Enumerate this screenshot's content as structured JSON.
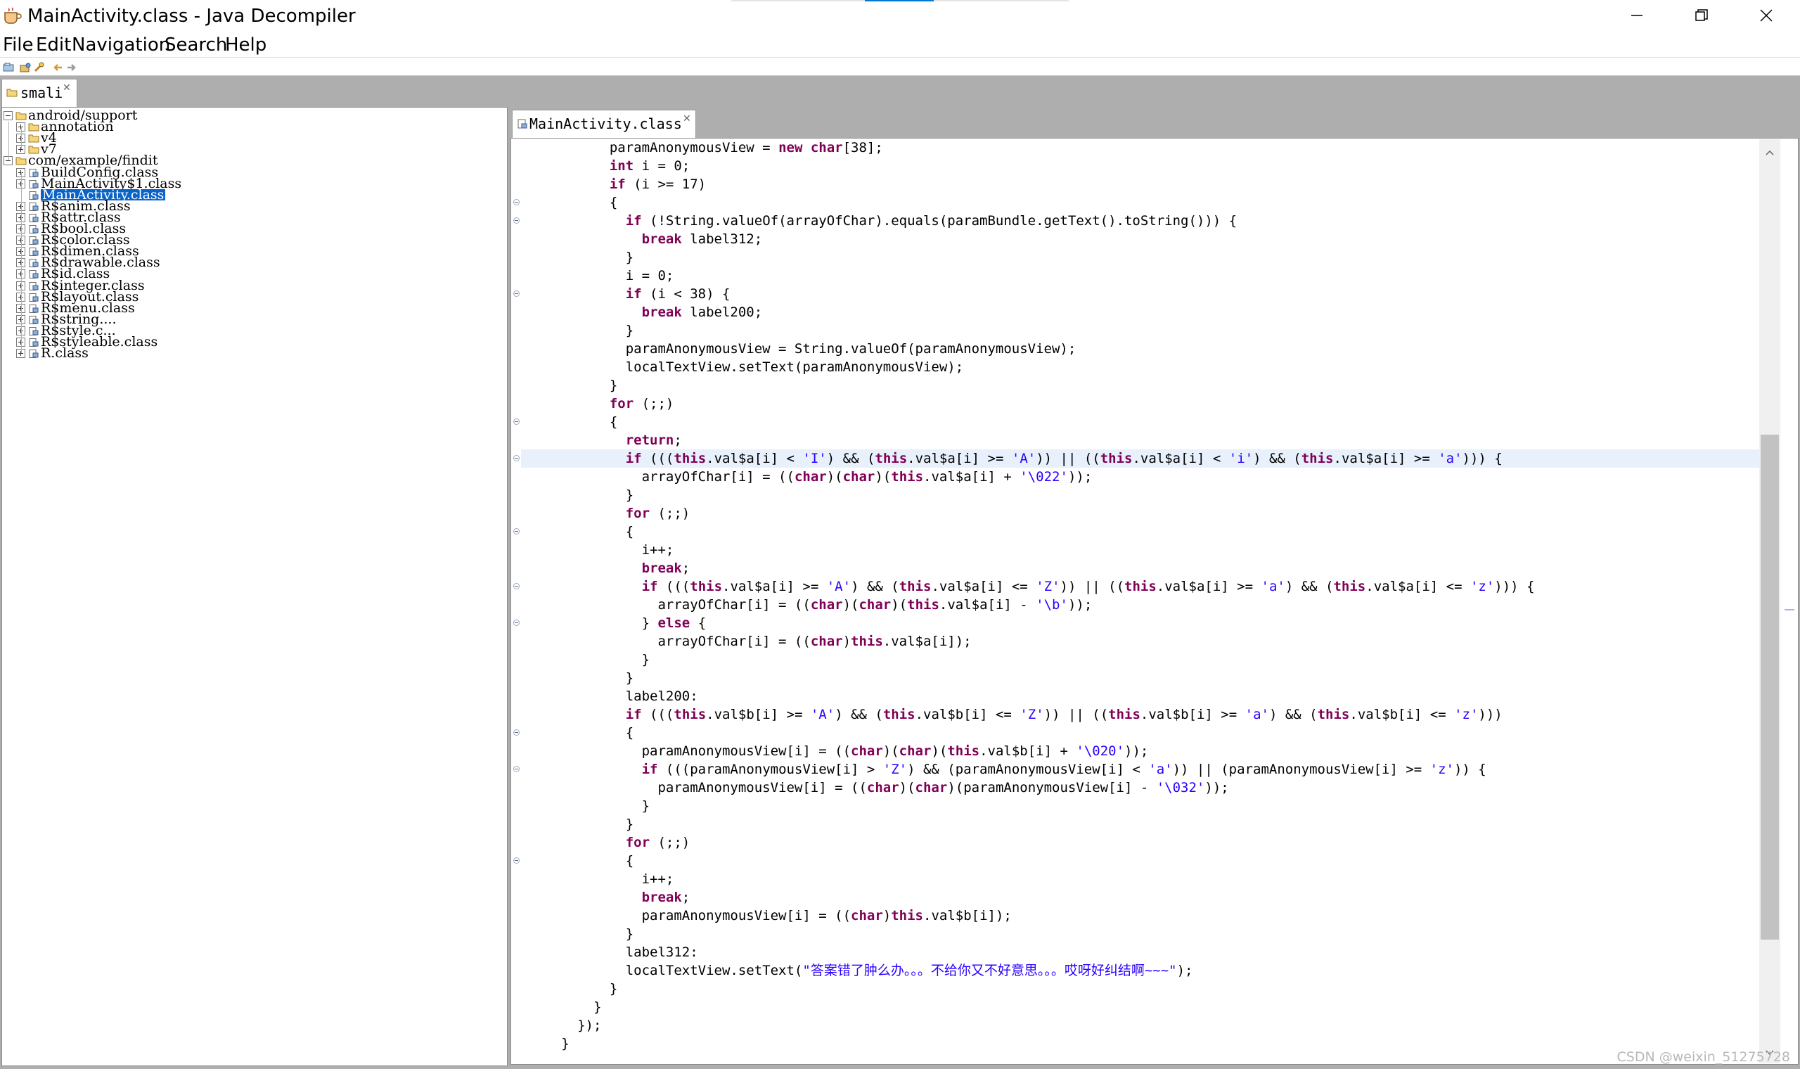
{
  "window": {
    "title": "MainActivity.class - Java Decompiler"
  },
  "menu": [
    "File",
    "Edit",
    "Navigation",
    "Search",
    "Help"
  ],
  "left_tab": {
    "label": "smali"
  },
  "tree": [
    {
      "label": "android/support",
      "level": 0,
      "expander": "minus",
      "icon": "folder"
    },
    {
      "label": "annotation",
      "level": 1,
      "expander": "plus",
      "icon": "folder"
    },
    {
      "label": "v4",
      "level": 1,
      "expander": "plus",
      "icon": "folder"
    },
    {
      "label": "v7",
      "level": 1,
      "expander": "plus",
      "icon": "folder"
    },
    {
      "label": "com/example/findit",
      "level": 0,
      "expander": "minus",
      "icon": "folder"
    },
    {
      "label": "BuildConfig.class",
      "level": 1,
      "expander": "plus",
      "icon": "class"
    },
    {
      "label": "MainActivity$1.class",
      "level": 1,
      "expander": "plus",
      "icon": "class"
    },
    {
      "label": "MainActivity.class",
      "level": 1,
      "expander": "none",
      "icon": "class",
      "selected": true
    },
    {
      "label": "R$anim.class",
      "level": 1,
      "expander": "plus",
      "icon": "class"
    },
    {
      "label": "R$attr.class",
      "level": 1,
      "expander": "plus",
      "icon": "class"
    },
    {
      "label": "R$bool.class",
      "level": 1,
      "expander": "plus",
      "icon": "class"
    },
    {
      "label": "R$color.class",
      "level": 1,
      "expander": "plus",
      "icon": "class"
    },
    {
      "label": "R$dimen.class",
      "level": 1,
      "expander": "plus",
      "icon": "class"
    },
    {
      "label": "R$drawable.class",
      "level": 1,
      "expander": "plus",
      "icon": "class"
    },
    {
      "label": "R$id.class",
      "level": 1,
      "expander": "plus",
      "icon": "class"
    },
    {
      "label": "R$integer.class",
      "level": 1,
      "expander": "plus",
      "icon": "class"
    },
    {
      "label": "R$layout.class",
      "level": 1,
      "expander": "plus",
      "icon": "class"
    },
    {
      "label": "R$menu.class",
      "level": 1,
      "expander": "plus",
      "icon": "class"
    },
    {
      "label": "R$string....",
      "level": 1,
      "expander": "plus",
      "icon": "class"
    },
    {
      "label": "R$style.c...",
      "level": 1,
      "expander": "plus",
      "icon": "class"
    },
    {
      "label": "R$styleable.class",
      "level": 1,
      "expander": "plus",
      "icon": "class"
    },
    {
      "label": "R.class",
      "level": 1,
      "expander": "plus",
      "icon": "class"
    }
  ],
  "right_tab": {
    "label": "MainActivity.class"
  },
  "code": [
    {
      "indent": 10,
      "segs": [
        [
          "t",
          "paramAnonymousView = "
        ],
        [
          "k",
          "new"
        ],
        [
          "t",
          " "
        ],
        [
          "k",
          "char"
        ],
        [
          "t",
          "[38];"
        ]
      ]
    },
    {
      "indent": 10,
      "segs": [
        [
          "k",
          "int"
        ],
        [
          "t",
          " i = 0;"
        ]
      ]
    },
    {
      "indent": 10,
      "segs": [
        [
          "k",
          "if"
        ],
        [
          "t",
          " (i >= 17)"
        ]
      ]
    },
    {
      "indent": 10,
      "fold": true,
      "segs": [
        [
          "t",
          "{"
        ]
      ]
    },
    {
      "indent": 12,
      "fold": true,
      "segs": [
        [
          "k",
          "if"
        ],
        [
          "t",
          " (!String.valueOf(arrayOfChar).equals(paramBundle.getText().toString())) {"
        ]
      ]
    },
    {
      "indent": 14,
      "segs": [
        [
          "k",
          "break"
        ],
        [
          "t",
          " label312;"
        ]
      ]
    },
    {
      "indent": 12,
      "segs": [
        [
          "t",
          "}"
        ]
      ]
    },
    {
      "indent": 12,
      "segs": [
        [
          "t",
          "i = 0;"
        ]
      ]
    },
    {
      "indent": 12,
      "fold": true,
      "segs": [
        [
          "k",
          "if"
        ],
        [
          "t",
          " (i < 38) {"
        ]
      ]
    },
    {
      "indent": 14,
      "segs": [
        [
          "k",
          "break"
        ],
        [
          "t",
          " label200;"
        ]
      ]
    },
    {
      "indent": 12,
      "segs": [
        [
          "t",
          "}"
        ]
      ]
    },
    {
      "indent": 12,
      "segs": [
        [
          "t",
          "paramAnonymousView = String.valueOf(paramAnonymousView);"
        ]
      ]
    },
    {
      "indent": 12,
      "segs": [
        [
          "t",
          "localTextView.setText(paramAnonymousView);"
        ]
      ]
    },
    {
      "indent": 10,
      "segs": [
        [
          "t",
          "}"
        ]
      ]
    },
    {
      "indent": 10,
      "segs": [
        [
          "k",
          "for"
        ],
        [
          "t",
          " (;;)"
        ]
      ]
    },
    {
      "indent": 10,
      "fold": true,
      "segs": [
        [
          "t",
          "{"
        ]
      ]
    },
    {
      "indent": 12,
      "segs": [
        [
          "k",
          "return"
        ],
        [
          "t",
          ";"
        ]
      ]
    },
    {
      "indent": 12,
      "fold": true,
      "hl": true,
      "segs": [
        [
          "k",
          "if"
        ],
        [
          "t",
          " ((("
        ],
        [
          "k",
          "this"
        ],
        [
          "t",
          ".val$a[i] < "
        ],
        [
          "s",
          "'I'"
        ],
        [
          "t",
          ") && ("
        ],
        [
          "k",
          "this"
        ],
        [
          "t",
          ".val$a[i] >= "
        ],
        [
          "s",
          "'A'"
        ],
        [
          "t",
          ")) || (("
        ],
        [
          "k",
          "this"
        ],
        [
          "t",
          ".val$a[i] < "
        ],
        [
          "s",
          "'i'"
        ],
        [
          "t",
          ") && ("
        ],
        [
          "k",
          "this"
        ],
        [
          "t",
          ".val$a[i] >= "
        ],
        [
          "s",
          "'a'"
        ],
        [
          "t",
          "))) {"
        ]
      ]
    },
    {
      "indent": 14,
      "segs": [
        [
          "t",
          "arrayOfChar[i] = (("
        ],
        [
          "k",
          "char"
        ],
        [
          "t",
          ")("
        ],
        [
          "k",
          "char"
        ],
        [
          "t",
          ")("
        ],
        [
          "k",
          "this"
        ],
        [
          "t",
          ".val$a[i] + "
        ],
        [
          "s",
          "'\\022'"
        ],
        [
          "t",
          "));"
        ]
      ]
    },
    {
      "indent": 12,
      "segs": [
        [
          "t",
          "}"
        ]
      ]
    },
    {
      "indent": 12,
      "segs": [
        [
          "k",
          "for"
        ],
        [
          "t",
          " (;;)"
        ]
      ]
    },
    {
      "indent": 12,
      "fold": true,
      "segs": [
        [
          "t",
          "{"
        ]
      ]
    },
    {
      "indent": 14,
      "segs": [
        [
          "t",
          "i++;"
        ]
      ]
    },
    {
      "indent": 14,
      "segs": [
        [
          "k",
          "break"
        ],
        [
          "t",
          ";"
        ]
      ]
    },
    {
      "indent": 14,
      "fold": true,
      "segs": [
        [
          "k",
          "if"
        ],
        [
          "t",
          " ((("
        ],
        [
          "k",
          "this"
        ],
        [
          "t",
          ".val$a[i] >= "
        ],
        [
          "s",
          "'A'"
        ],
        [
          "t",
          ") && ("
        ],
        [
          "k",
          "this"
        ],
        [
          "t",
          ".val$a[i] <= "
        ],
        [
          "s",
          "'Z'"
        ],
        [
          "t",
          ")) || (("
        ],
        [
          "k",
          "this"
        ],
        [
          "t",
          ".val$a[i] >= "
        ],
        [
          "s",
          "'a'"
        ],
        [
          "t",
          ") && ("
        ],
        [
          "k",
          "this"
        ],
        [
          "t",
          ".val$a[i] <= "
        ],
        [
          "s",
          "'z'"
        ],
        [
          "t",
          "))) {"
        ]
      ]
    },
    {
      "indent": 16,
      "segs": [
        [
          "t",
          "arrayOfChar[i] = (("
        ],
        [
          "k",
          "char"
        ],
        [
          "t",
          ")("
        ],
        [
          "k",
          "char"
        ],
        [
          "t",
          ")("
        ],
        [
          "k",
          "this"
        ],
        [
          "t",
          ".val$a[i] - "
        ],
        [
          "s",
          "'\\b'"
        ],
        [
          "t",
          "));"
        ]
      ]
    },
    {
      "indent": 14,
      "fold": true,
      "segs": [
        [
          "t",
          "} "
        ],
        [
          "k",
          "else"
        ],
        [
          "t",
          " {"
        ]
      ]
    },
    {
      "indent": 16,
      "segs": [
        [
          "t",
          "arrayOfChar[i] = (("
        ],
        [
          "k",
          "char"
        ],
        [
          "t",
          ")"
        ],
        [
          "k",
          "this"
        ],
        [
          "t",
          ".val$a[i]);"
        ]
      ]
    },
    {
      "indent": 14,
      "segs": [
        [
          "t",
          "}"
        ]
      ]
    },
    {
      "indent": 12,
      "segs": [
        [
          "t",
          "}"
        ]
      ]
    },
    {
      "indent": 12,
      "segs": [
        [
          "t",
          "label200:"
        ]
      ]
    },
    {
      "indent": 12,
      "segs": [
        [
          "k",
          "if"
        ],
        [
          "t",
          " ((("
        ],
        [
          "k",
          "this"
        ],
        [
          "t",
          ".val$b[i] >= "
        ],
        [
          "s",
          "'A'"
        ],
        [
          "t",
          ") && ("
        ],
        [
          "k",
          "this"
        ],
        [
          "t",
          ".val$b[i] <= "
        ],
        [
          "s",
          "'Z'"
        ],
        [
          "t",
          ")) || (("
        ],
        [
          "k",
          "this"
        ],
        [
          "t",
          ".val$b[i] >= "
        ],
        [
          "s",
          "'a'"
        ],
        [
          "t",
          ") && ("
        ],
        [
          "k",
          "this"
        ],
        [
          "t",
          ".val$b[i] <= "
        ],
        [
          "s",
          "'z'"
        ],
        [
          "t",
          ")))"
        ]
      ]
    },
    {
      "indent": 12,
      "fold": true,
      "segs": [
        [
          "t",
          "{"
        ]
      ]
    },
    {
      "indent": 14,
      "segs": [
        [
          "t",
          "paramAnonymousView[i] = (("
        ],
        [
          "k",
          "char"
        ],
        [
          "t",
          ")("
        ],
        [
          "k",
          "char"
        ],
        [
          "t",
          ")("
        ],
        [
          "k",
          "this"
        ],
        [
          "t",
          ".val$b[i] + "
        ],
        [
          "s",
          "'\\020'"
        ],
        [
          "t",
          "));"
        ]
      ]
    },
    {
      "indent": 14,
      "fold": true,
      "segs": [
        [
          "k",
          "if"
        ],
        [
          "t",
          " (((paramAnonymousView[i] > "
        ],
        [
          "s",
          "'Z'"
        ],
        [
          "t",
          ") && (paramAnonymousView[i] < "
        ],
        [
          "s",
          "'a'"
        ],
        [
          "t",
          ")) || (paramAnonymousView[i] >= "
        ],
        [
          "s",
          "'z'"
        ],
        [
          "t",
          ")) {"
        ]
      ]
    },
    {
      "indent": 16,
      "segs": [
        [
          "t",
          "paramAnonymousView[i] = (("
        ],
        [
          "k",
          "char"
        ],
        [
          "t",
          ")("
        ],
        [
          "k",
          "char"
        ],
        [
          "t",
          ")(paramAnonymousView[i] - "
        ],
        [
          "s",
          "'\\032'"
        ],
        [
          "t",
          "));"
        ]
      ]
    },
    {
      "indent": 14,
      "segs": [
        [
          "t",
          "}"
        ]
      ]
    },
    {
      "indent": 12,
      "segs": [
        [
          "t",
          "}"
        ]
      ]
    },
    {
      "indent": 12,
      "segs": [
        [
          "k",
          "for"
        ],
        [
          "t",
          " (;;)"
        ]
      ]
    },
    {
      "indent": 12,
      "fold": true,
      "segs": [
        [
          "t",
          "{"
        ]
      ]
    },
    {
      "indent": 14,
      "segs": [
        [
          "t",
          "i++;"
        ]
      ]
    },
    {
      "indent": 14,
      "segs": [
        [
          "k",
          "break"
        ],
        [
          "t",
          ";"
        ]
      ]
    },
    {
      "indent": 14,
      "segs": [
        [
          "t",
          "paramAnonymousView[i] = (("
        ],
        [
          "k",
          "char"
        ],
        [
          "t",
          ")"
        ],
        [
          "k",
          "this"
        ],
        [
          "t",
          ".val$b[i]);"
        ]
      ]
    },
    {
      "indent": 12,
      "segs": [
        [
          "t",
          "}"
        ]
      ]
    },
    {
      "indent": 12,
      "segs": [
        [
          "t",
          "label312:"
        ]
      ]
    },
    {
      "indent": 12,
      "segs": [
        [
          "t",
          "localTextView.setText("
        ],
        [
          "s",
          "\"答案错了肿么办。。。不给你又不好意思。。。哎呀好纠结啊~~~\""
        ],
        [
          "t",
          ");"
        ]
      ]
    },
    {
      "indent": 10,
      "segs": [
        [
          "t",
          "}"
        ]
      ]
    },
    {
      "indent": 8,
      "segs": [
        [
          "t",
          "}"
        ]
      ]
    },
    {
      "indent": 6,
      "segs": [
        [
          "t",
          "});"
        ]
      ]
    },
    {
      "indent": 4,
      "segs": [
        [
          "t",
          "}"
        ]
      ]
    }
  ],
  "watermark": "CSDN @weixin_51275728",
  "colors": {
    "keyword": "#7f0055",
    "string": "#2a00ff",
    "selection": "#0a63c8",
    "line_highlight": "#e8f0fb"
  }
}
